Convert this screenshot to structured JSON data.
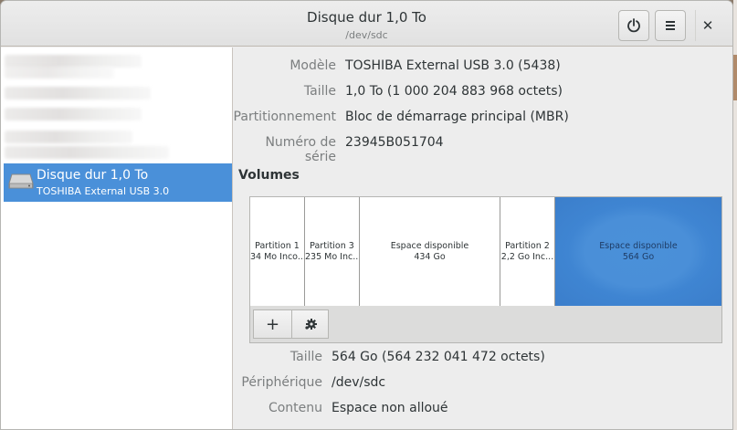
{
  "window": {
    "title": "Disque dur 1,0 To",
    "subtitle": "/dev/sdc",
    "buttons": {
      "power_icon": "power-icon",
      "menu_icon": "hamburger-menu-icon",
      "close_glyph": "✕"
    }
  },
  "sidebar": {
    "selected_drive": {
      "name": "Disque dur 1,0 To",
      "model": "TOSHIBA External USB 3.0",
      "icon": "hard-drive-icon"
    }
  },
  "drive_info": {
    "rows": [
      {
        "label": "Modèle",
        "value": "TOSHIBA External USB 3.0 (5438)"
      },
      {
        "label": "Taille",
        "value": "1,0 To (1 000 204 883 968 octets)"
      },
      {
        "label": "Partitionnement",
        "value": "Bloc de démarrage principal (MBR)"
      },
      {
        "label": "Numéro de série",
        "value": "23945B051704"
      }
    ]
  },
  "volumes": {
    "heading": "Volumes",
    "segments": [
      {
        "line1": "Partition 1",
        "line2": "34 Mo Inco..."
      },
      {
        "line1": "Partition 3",
        "line2": "235 Mo Inc..."
      },
      {
        "line1": "Espace disponible",
        "line2": "434 Go"
      },
      {
        "line1": "Partition 2",
        "line2": "2,2 Go Inc..."
      },
      {
        "line1": "Espace disponible",
        "line2": "564 Go",
        "selected": true
      }
    ],
    "toolbar": {
      "add_label": "+",
      "settings_icon": "gear-icon"
    }
  },
  "volume_info": {
    "rows": [
      {
        "label": "Taille",
        "value": "564 Go (564 232 041 472 octets)"
      },
      {
        "label": "Périphérique",
        "value": "/dev/sdc"
      },
      {
        "label": "Contenu",
        "value": "Espace non alloué"
      }
    ]
  },
  "colors": {
    "selection": "#4a90d9",
    "window_bg": "#ededed",
    "label_gray": "#7b7e7f"
  }
}
